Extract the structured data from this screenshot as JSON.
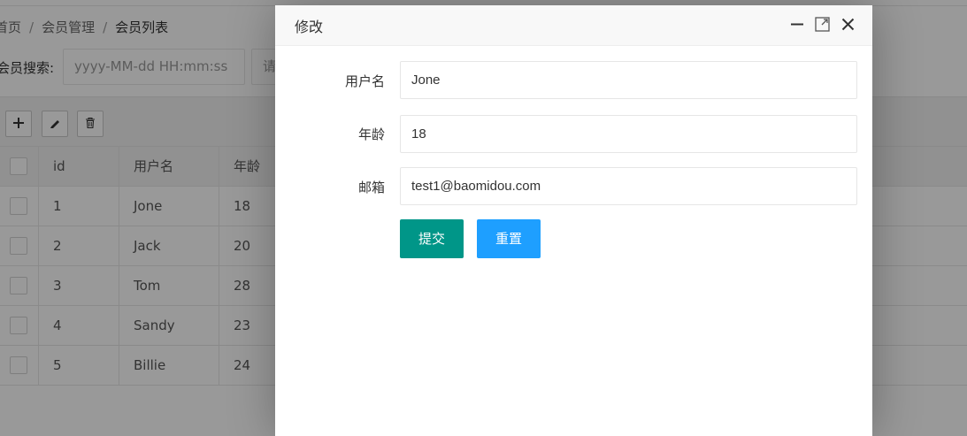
{
  "breadcrumb": {
    "home": "首页",
    "separator": "/",
    "member_mgmt": "会员管理",
    "member_list": "会员列表"
  },
  "search": {
    "label": "会员搜索:",
    "date_placeholder": "yyyy-MM-dd HH:mm:ss",
    "text_placeholder": "请"
  },
  "table": {
    "headers": [
      "",
      "id",
      "用户名",
      "年龄"
    ],
    "rows": [
      {
        "id": "1",
        "name": "Jone",
        "age": "18"
      },
      {
        "id": "2",
        "name": "Jack",
        "age": "20"
      },
      {
        "id": "3",
        "name": "Tom",
        "age": "28"
      },
      {
        "id": "4",
        "name": "Sandy",
        "age": "23"
      },
      {
        "id": "5",
        "name": "Billie",
        "age": "24"
      }
    ]
  },
  "toolbar_icons": [
    "plus-icon",
    "pencil-icon",
    "trash-icon"
  ],
  "modal": {
    "title": "修改",
    "fields": {
      "username": {
        "label": "用户名",
        "value": "Jone"
      },
      "age": {
        "label": "年龄",
        "value": "18"
      },
      "email": {
        "label": "邮箱",
        "value": "test1@baomidou.com"
      }
    },
    "submit_label": "提交",
    "reset_label": "重置"
  },
  "colors": {
    "submit": "#009688",
    "reset": "#1e9fff",
    "shade": "rgba(0,0,0,0.4)"
  }
}
